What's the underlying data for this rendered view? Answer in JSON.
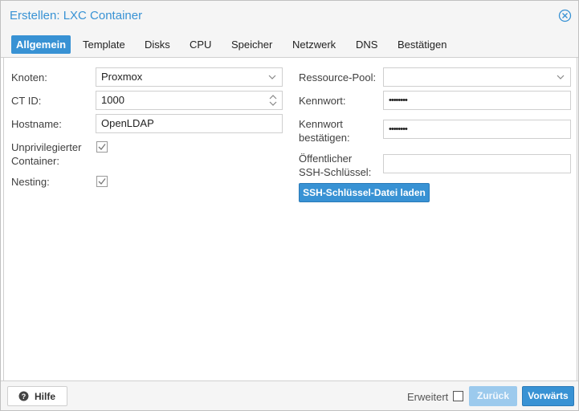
{
  "window": {
    "title": "Erstellen: LXC Container",
    "accent_color": "#3892d4"
  },
  "tabs": [
    {
      "label": "Allgemein",
      "active": true
    },
    {
      "label": "Template",
      "active": false
    },
    {
      "label": "Disks",
      "active": false
    },
    {
      "label": "CPU",
      "active": false
    },
    {
      "label": "Speicher",
      "active": false
    },
    {
      "label": "Netzwerk",
      "active": false
    },
    {
      "label": "DNS",
      "active": false
    },
    {
      "label": "Bestätigen",
      "active": false
    }
  ],
  "left": {
    "node_label": "Knoten:",
    "node_value": "Proxmox",
    "ctid_label": "CT ID:",
    "ctid_value": "1000",
    "hostname_label": "Hostname:",
    "hostname_value": "OpenLDAP",
    "unpriv_label_1": "Unprivilegierter",
    "unpriv_label_2": "Container:",
    "unpriv_checked": true,
    "nesting_label": "Nesting:",
    "nesting_checked": true
  },
  "right": {
    "pool_label": "Ressource-Pool:",
    "pool_value": "",
    "password_label": "Kennwort:",
    "password_value": "••••••••",
    "confirm_label_1": "Kennwort",
    "confirm_label_2": "bestätigen:",
    "confirm_value": "••••••••",
    "ssh_label_1": "Öffentlicher",
    "ssh_label_2": "SSH-Schlüssel:",
    "ssh_value": "",
    "ssh_load_button": "SSH-Schlüssel-Datei laden"
  },
  "footer": {
    "help_label": "Hilfe",
    "advanced_label": "Erweitert",
    "advanced_checked": false,
    "back_label": "Zurück",
    "next_label": "Vorwärts"
  }
}
